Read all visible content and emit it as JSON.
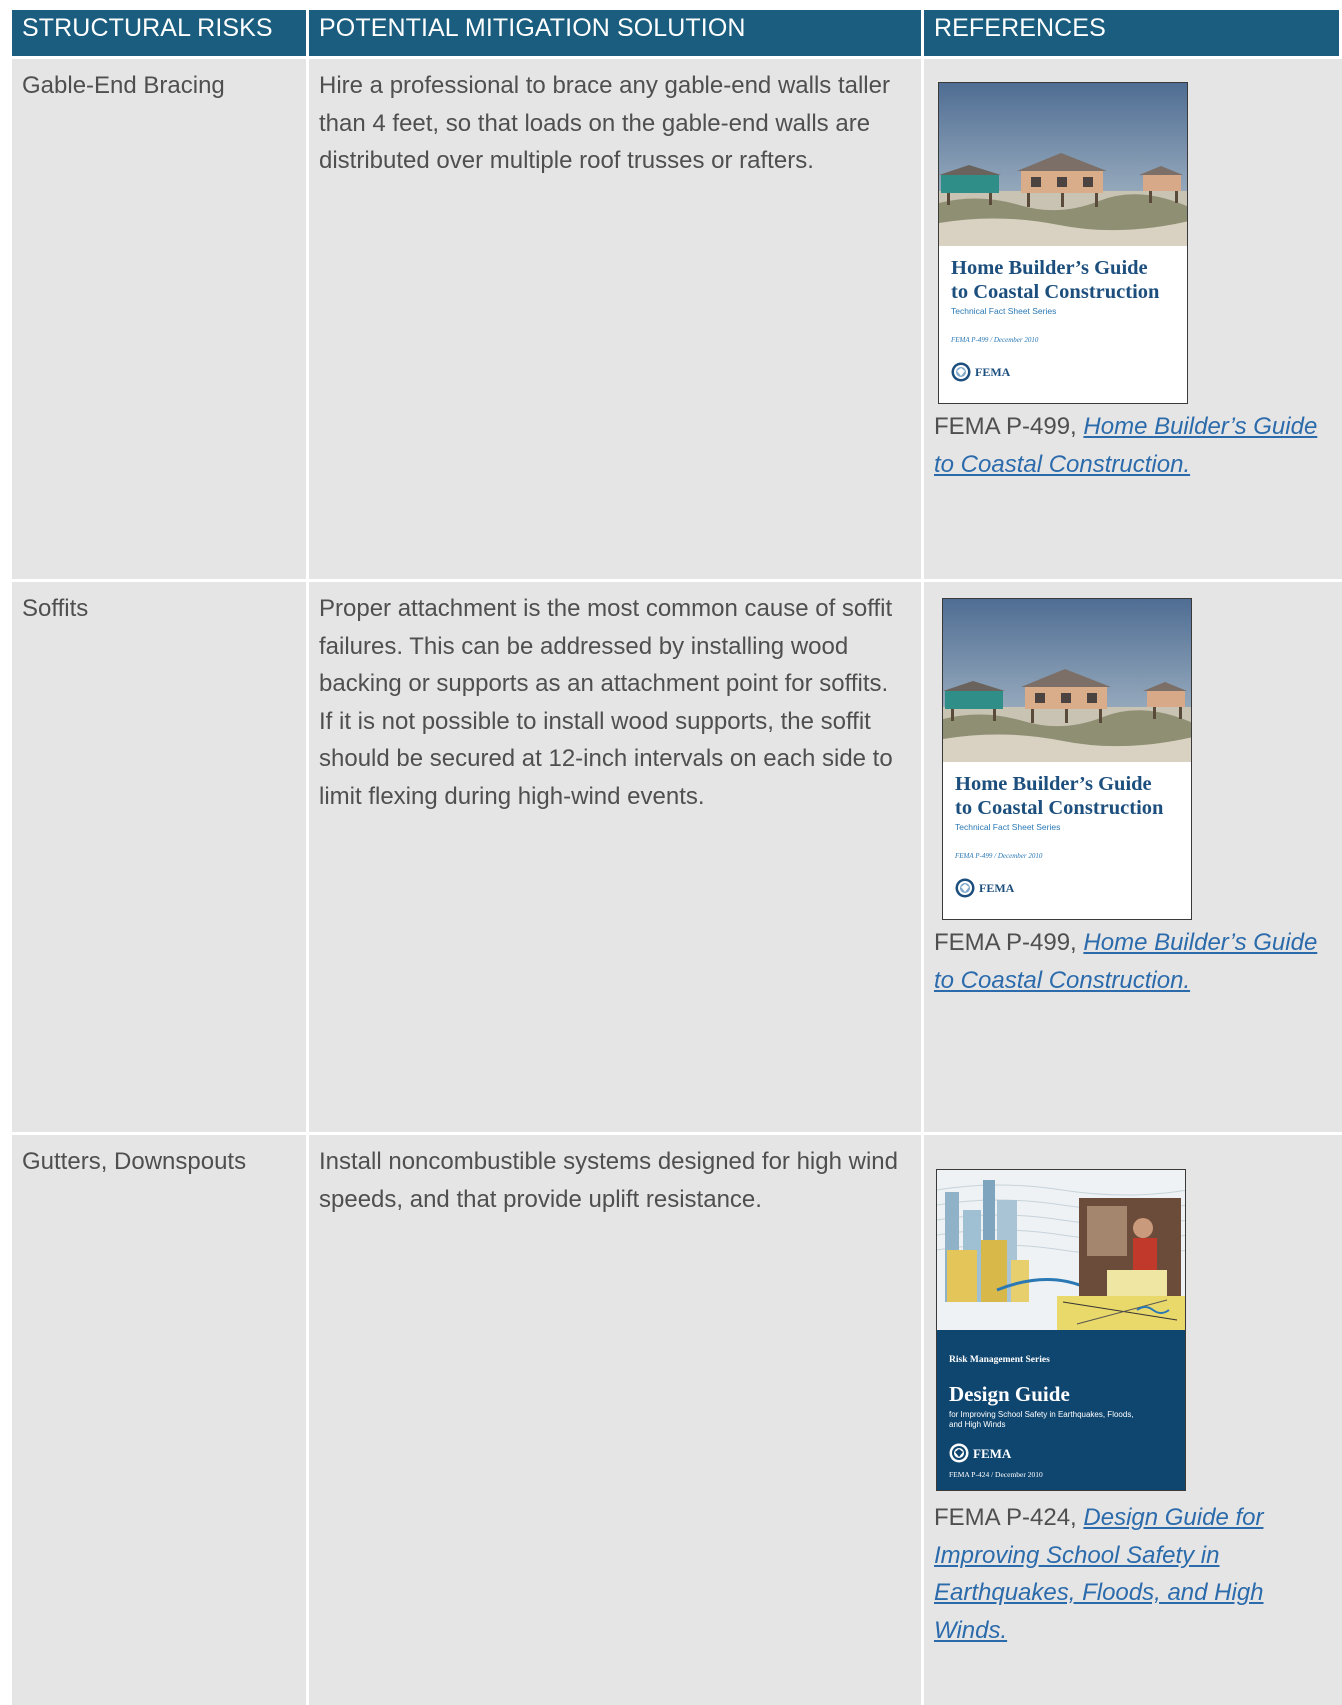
{
  "header": {
    "col1": "STRUCTURAL RISKS",
    "col2": "POTENTIAL MITIGATION SOLUTION",
    "col3": "REFERENCES"
  },
  "rows": [
    {
      "risk": "Gable-End Bracing",
      "solution": "Hire a professional to brace any gable-end walls taller than 4 feet, so that loads on the gable-end walls are distributed over multiple roof trusses or rafters.",
      "reference": {
        "cover": {
          "title_line1": "Home Builder’s Guide",
          "title_line2": "to Coastal Construction",
          "subtitle": "Technical Fact Sheet Series",
          "number": "FEMA P-499 / December 2010",
          "agency": "FEMA"
        },
        "citation_prefix": "FEMA P-499, ",
        "citation_link": "Home Builder’s Guide to Coastal Construction."
      }
    },
    {
      "risk": "Soffits",
      "solution": "Proper attachment is the most common cause of soffit failures. This can be addressed by installing wood backing or supports as an attachment point for soffits. If it is not possible to install wood supports, the soffit should be secured at 12-inch intervals on each side to limit flexing during high-wind events.",
      "reference": {
        "cover": {
          "title_line1": "Home Builder’s Guide",
          "title_line2": "to Coastal Construction",
          "subtitle": "Technical Fact Sheet Series",
          "number": "FEMA P-499 / December 2010",
          "agency": "FEMA"
        },
        "citation_prefix": "FEMA P-499, ",
        "citation_link": "Home Builder’s Guide to Coastal Construction."
      }
    },
    {
      "risk": "Gutters, Downspouts",
      "solution": "Install noncombustible systems designed for high wind speeds, and that provide uplift resistance.",
      "reference": {
        "cover": {
          "series": "Risk Management Series",
          "title": "Design Guide",
          "subtitle": "for Improving School Safety in Earthquakes, Floods, and High Winds",
          "number": "FEMA P-424 / December 2010",
          "agency": "FEMA"
        },
        "citation_prefix": "FEMA P-424, ",
        "citation_link": "Design Guide for Improving School Safety in Earthquakes, Floods, and High Winds."
      }
    }
  ],
  "colors": {
    "header_bg": "#1a5d7e",
    "cell_bg": "#e6e5e6",
    "link": "#2b6bab"
  }
}
